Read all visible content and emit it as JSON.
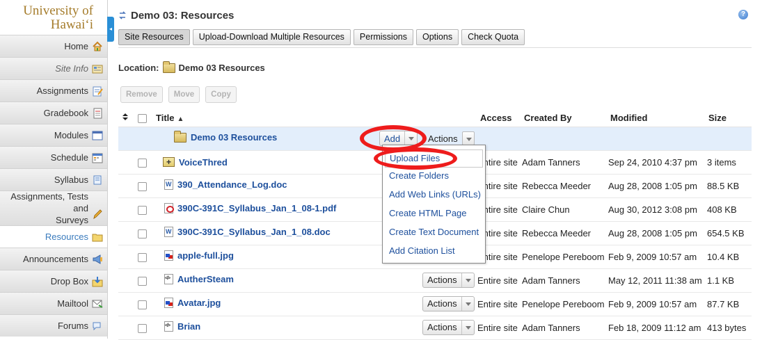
{
  "logo": {
    "line1": "University of",
    "line2": "Hawai‘i"
  },
  "sidebar": {
    "items": [
      {
        "label": "Home",
        "icon": "home-icon"
      },
      {
        "label": "Site Info",
        "icon": "site-info-icon"
      },
      {
        "label": "Assignments",
        "icon": "assignments-icon"
      },
      {
        "label": "Gradebook",
        "icon": "gradebook-icon"
      },
      {
        "label": "Modules",
        "icon": "modules-icon"
      },
      {
        "label": "Schedule",
        "icon": "schedule-icon"
      },
      {
        "label": "Syllabus",
        "icon": "syllabus-icon"
      },
      {
        "label": "Assignments, Tests and",
        "label2": "Surveys",
        "icon": "pencil-icon"
      },
      {
        "label": "Resources",
        "icon": "folder-icon"
      },
      {
        "label": "Announcements",
        "icon": "megaphone-icon"
      },
      {
        "label": "Drop Box",
        "icon": "dropbox-icon"
      },
      {
        "label": "Mailtool",
        "icon": "mail-icon"
      },
      {
        "label": "Forums",
        "icon": "forums-icon"
      }
    ]
  },
  "page": {
    "title": "Demo 03: Resources",
    "help": "?"
  },
  "tabs": [
    "Site Resources",
    "Upload-Download Multiple Resources",
    "Permissions",
    "Options",
    "Check Quota"
  ],
  "location": {
    "label": "Location:",
    "value": "Demo 03 Resources"
  },
  "bulk": {
    "remove": "Remove",
    "move": "Move",
    "copy": "Copy"
  },
  "table": {
    "headers": {
      "title": "Title",
      "access": "Access",
      "created_by": "Created By",
      "modified": "Modified",
      "size": "Size"
    },
    "root": {
      "name": "Demo 03 Resources",
      "add": "Add",
      "actions": "Actions"
    },
    "rows": [
      {
        "name": "VoiceThred",
        "type": "folder",
        "access": "Entire site",
        "created_by": "Adam Tanners",
        "modified": "Sep 24, 2010 4:37 pm",
        "size": "3 items"
      },
      {
        "name": "390_Attendance_Log.doc",
        "type": "word",
        "access": "Entire site",
        "created_by": "Rebecca Meeder",
        "modified": "Aug 28, 2008 1:05 pm",
        "size": "88.5 KB"
      },
      {
        "name": "390C-391C_Syllabus_Jan_1_08-1.pdf",
        "type": "pdf",
        "access": "Entire site",
        "created_by": "Claire Chun",
        "modified": "Aug 30, 2012 3:08 pm",
        "size": "408 KB"
      },
      {
        "name": "390C-391C_Syllabus_Jan_1_08.doc",
        "type": "word",
        "access": "Entire site",
        "created_by": "Rebecca Meeder",
        "modified": "Aug 28, 2008 1:05 pm",
        "size": "654.5 KB"
      },
      {
        "name": "apple-full.jpg",
        "type": "img",
        "access": "Entire site",
        "created_by": "Penelope Pereboom",
        "modified": "Feb 9, 2009 10:57 am",
        "size": "10.4 KB"
      },
      {
        "name": "AutherSteam",
        "type": "code",
        "actions": "Actions",
        "access": "Entire site",
        "created_by": "Adam Tanners",
        "modified": "May 12, 2011 11:38 am",
        "size": "1.1 KB"
      },
      {
        "name": "Avatar.jpg",
        "type": "img",
        "actions": "Actions",
        "access": "Entire site",
        "created_by": "Penelope Pereboom",
        "modified": "Feb 9, 2009 10:57 am",
        "size": "87.7 KB"
      },
      {
        "name": "Brian",
        "type": "code",
        "actions": "Actions",
        "access": "Entire site",
        "created_by": "Adam Tanners",
        "modified": "Feb 18, 2009 11:12 am",
        "size": "413 bytes"
      }
    ]
  },
  "add_menu": [
    "Upload Files",
    "Create Folders",
    "Add Web Links (URLs)",
    "Create HTML Page",
    "Create Text Document",
    "Add Citation List"
  ],
  "colors": {
    "highlight_oval": "#ee1c1c",
    "link": "#1d4f9c",
    "accent": "#2a8fd6"
  }
}
